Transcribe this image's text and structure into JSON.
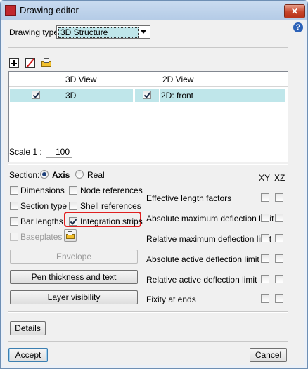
{
  "window": {
    "title": "Drawing editor",
    "close_symbol": "✕",
    "help_symbol": "?"
  },
  "drawing_type": {
    "label": "Drawing type",
    "value": "3D Structure"
  },
  "toolbar": {
    "icons": [
      "add-icon",
      "delete-icon",
      "edit-icon"
    ]
  },
  "views_table": {
    "columns": [
      {
        "header": "3D View",
        "rows": [
          {
            "checked": true,
            "label": "3D"
          }
        ]
      },
      {
        "header": "2D View",
        "rows": [
          {
            "checked": true,
            "label": "2D: front"
          }
        ]
      }
    ]
  },
  "scale": {
    "label": "Scale  1 :",
    "value": "100"
  },
  "section": {
    "label": "Section:",
    "options": [
      {
        "label": "Axis",
        "selected": true
      },
      {
        "label": "Real",
        "selected": false
      }
    ]
  },
  "xy_xz": {
    "xy": "XY",
    "xz": "XZ"
  },
  "options": {
    "dimensions": {
      "label": "Dimensions",
      "checked": false
    },
    "node_references": {
      "label": "Node references",
      "checked": false
    },
    "section_type": {
      "label": "Section type",
      "checked": false
    },
    "shell_references": {
      "label": "Shell references",
      "checked": false
    },
    "bar_lengths": {
      "label": "Bar lengths",
      "checked": false
    },
    "integration_strips": {
      "label": "Integration strips",
      "checked": true
    },
    "baseplates": {
      "label": "Baseplates",
      "checked": false,
      "disabled": true
    }
  },
  "buttons": {
    "envelope": "Envelope",
    "pen_thickness": "Pen thickness and text",
    "layer_visibility": "Layer visibility",
    "details": "Details",
    "accept": "Accept",
    "cancel": "Cancel"
  },
  "right_options": [
    {
      "label": "Effective length factors",
      "xy": false,
      "xz": false
    },
    {
      "label": "Absolute maximum deflection limit",
      "xy": false,
      "xz": false
    },
    {
      "label": "Relative maximum deflection limit",
      "xy": false,
      "xz": false
    },
    {
      "label": "Absolute active deflection limit",
      "xy": false,
      "xz": false
    },
    {
      "label": "Relative active deflection limit",
      "xy": false,
      "xz": false
    },
    {
      "label": "Fixity at ends",
      "xy": false,
      "xz": false
    }
  ],
  "colors": {
    "selected_row": "#bfe6ea",
    "highlight_border": "#e02020",
    "help_icon": "#2c62b8"
  }
}
